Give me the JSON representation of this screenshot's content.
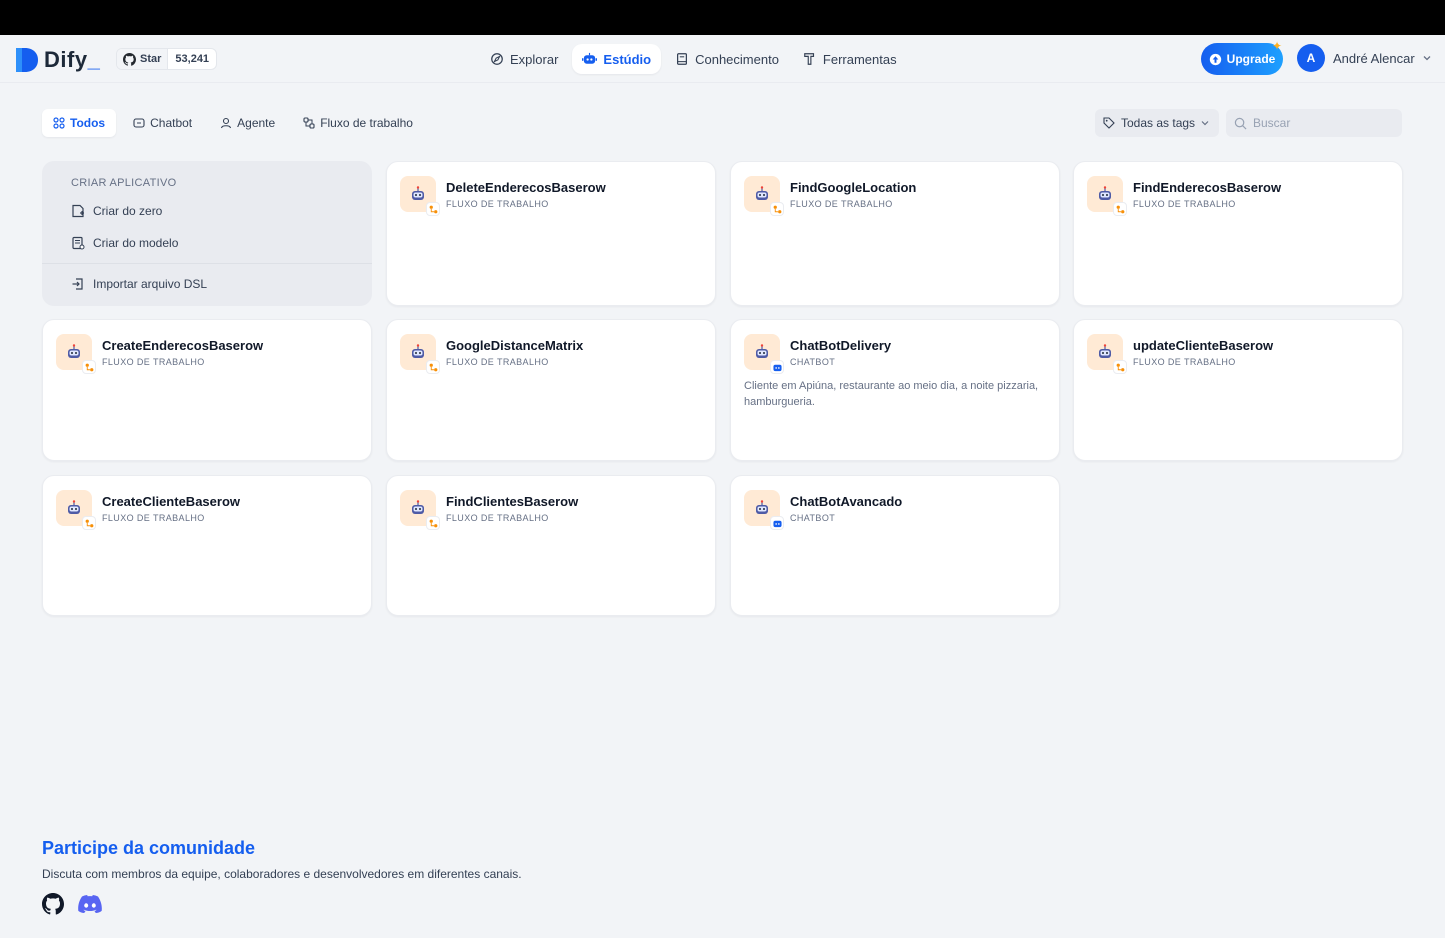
{
  "brand": {
    "name": "Dify",
    "accent": "#155eef"
  },
  "github": {
    "star_label": "Star",
    "star_count": "53,241"
  },
  "nav": [
    {
      "label": "Explorar",
      "icon": "compass-icon"
    },
    {
      "label": "Estúdio",
      "icon": "robot-icon",
      "active": true
    },
    {
      "label": "Conhecimento",
      "icon": "book-icon"
    },
    {
      "label": "Ferramentas",
      "icon": "tool-icon"
    }
  ],
  "upgrade": {
    "label": "Upgrade"
  },
  "user": {
    "initial": "A",
    "name": "André Alencar"
  },
  "filters": {
    "tabs": [
      {
        "label": "Todos",
        "active": true
      },
      {
        "label": "Chatbot"
      },
      {
        "label": "Agente"
      },
      {
        "label": "Fluxo de trabalho"
      }
    ],
    "tags_label": "Todas as tags",
    "search_placeholder": "Buscar"
  },
  "create": {
    "title": "CRIAR APLICATIVO",
    "from_scratch": "Criar do zero",
    "from_template": "Criar do modelo",
    "import_dsl": "Importar arquivo DSL"
  },
  "apps": [
    {
      "name": "DeleteEnderecosBaserow",
      "type": "FLUXO DE TRABALHO",
      "kind": "workflow",
      "description": ""
    },
    {
      "name": "FindGoogleLocation",
      "type": "FLUXO DE TRABALHO",
      "kind": "workflow",
      "description": ""
    },
    {
      "name": "FindEnderecosBaserow",
      "type": "FLUXO DE TRABALHO",
      "kind": "workflow",
      "description": ""
    },
    {
      "name": "CreateEnderecosBaserow",
      "type": "FLUXO DE TRABALHO",
      "kind": "workflow",
      "description": ""
    },
    {
      "name": "GoogleDistanceMatrix",
      "type": "FLUXO DE TRABALHO",
      "kind": "workflow",
      "description": ""
    },
    {
      "name": "ChatBotDelivery",
      "type": "CHATBOT",
      "kind": "chatbot",
      "description": "Cliente em Apiúna, restaurante ao meio dia, a noite pizzaria, hamburgueria."
    },
    {
      "name": "updateClienteBaserow",
      "type": "FLUXO DE TRABALHO",
      "kind": "workflow",
      "description": ""
    },
    {
      "name": "CreateClienteBaserow",
      "type": "FLUXO DE TRABALHO",
      "kind": "workflow",
      "description": ""
    },
    {
      "name": "FindClientesBaserow",
      "type": "FLUXO DE TRABALHO",
      "kind": "workflow",
      "description": ""
    },
    {
      "name": "ChatBotAvancado",
      "type": "CHATBOT",
      "kind": "chatbot",
      "description": ""
    }
  ],
  "community": {
    "title": "Participe da comunidade",
    "subtitle": "Discuta com membros da equipe, colaboradores e desenvolvedores em diferentes canais."
  }
}
